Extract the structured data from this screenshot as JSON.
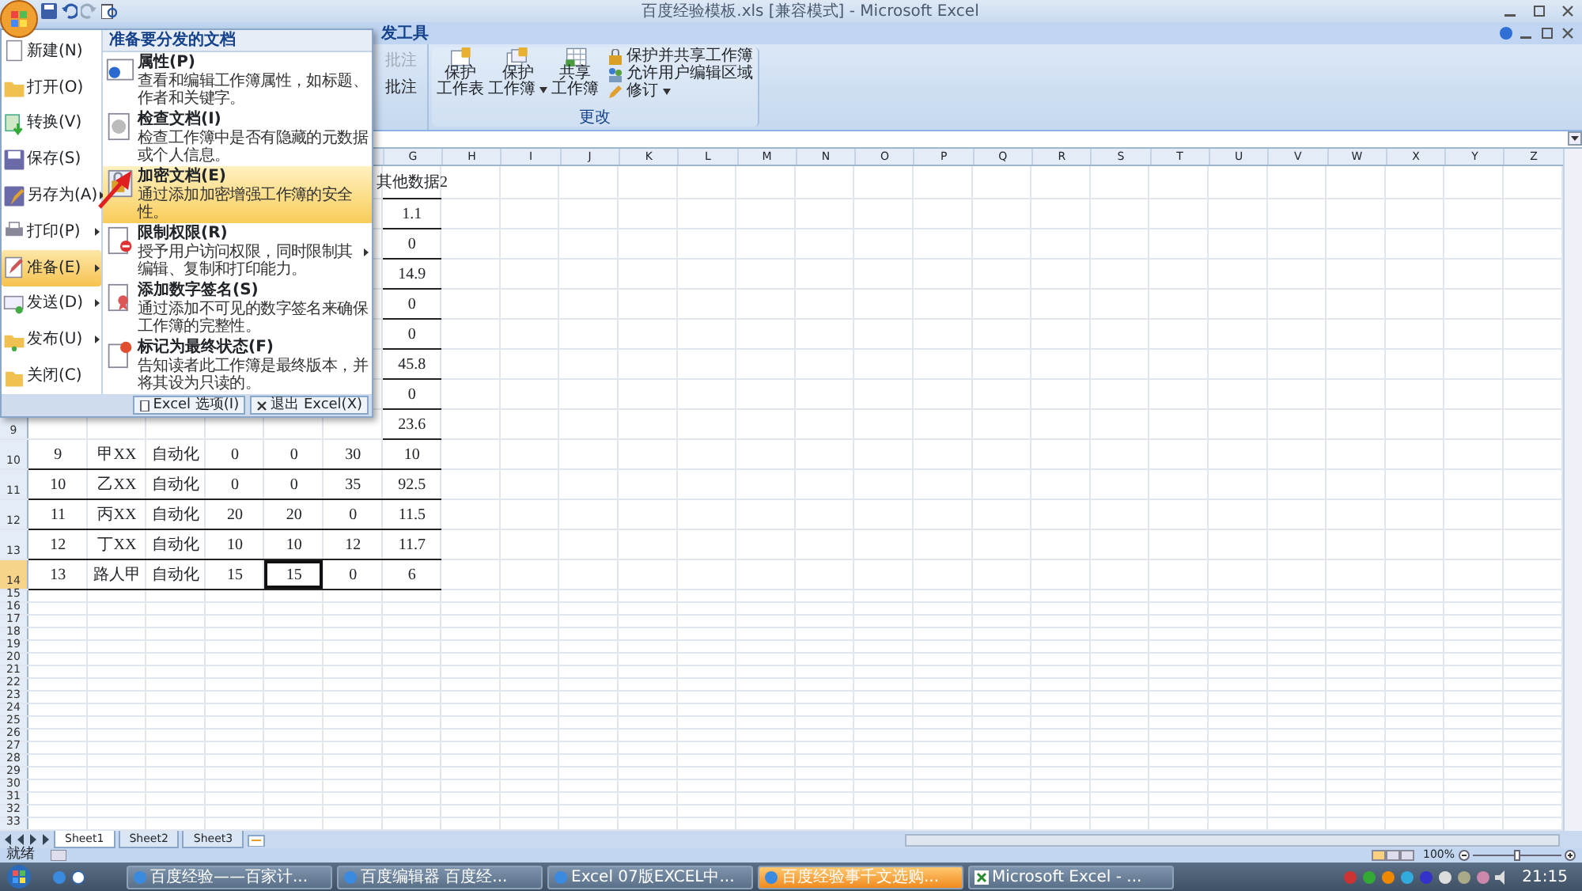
{
  "window": {
    "title": "百度经验模板.xls [兼容模式] - Microsoft Excel"
  },
  "ribbon": {
    "tab_partial": "发工具",
    "commands": [
      {
        "label": "批注",
        "disabled": true
      },
      {
        "label": "批注",
        "disabled": false
      }
    ],
    "group": {
      "title": "更改",
      "large_buttons": [
        {
          "lines": [
            "保护",
            "工作表"
          ],
          "has_menu": false
        },
        {
          "lines": [
            "保护",
            "工作簿"
          ],
          "has_menu": true
        },
        {
          "lines": [
            "共享",
            "工作簿"
          ],
          "has_menu": false
        }
      ],
      "small_buttons": [
        {
          "label": "保护并共享工作簿",
          "has_menu": false
        },
        {
          "label": "允许用户编辑区域",
          "has_menu": false
        },
        {
          "label": "修订",
          "has_menu": true
        }
      ]
    }
  },
  "office_menu": {
    "left_items": [
      {
        "label": "新建(N)",
        "submenu": false,
        "selected": false
      },
      {
        "label": "打开(O)",
        "submenu": false,
        "selected": false
      },
      {
        "label": "转换(V)",
        "submenu": false,
        "selected": false
      },
      {
        "label": "保存(S)",
        "submenu": false,
        "selected": false
      },
      {
        "label": "另存为(A)",
        "submenu": true,
        "selected": false
      },
      {
        "label": "打印(P)",
        "submenu": true,
        "selected": false
      },
      {
        "label": "准备(E)",
        "submenu": true,
        "selected": true
      },
      {
        "label": "发送(D)",
        "submenu": true,
        "selected": false
      },
      {
        "label": "发布(U)",
        "submenu": true,
        "selected": false
      },
      {
        "label": "关闭(C)",
        "submenu": false,
        "selected": false
      }
    ],
    "panel": {
      "title": "准备要分发的文档",
      "items": [
        {
          "title": "属性(P)",
          "description": "查看和编辑工作簿属性，如标题、作者和关键字。",
          "submenu": false,
          "selected": false
        },
        {
          "title": "检查文档(I)",
          "description": "检查工作簿中是否有隐藏的元数据或个人信息。",
          "submenu": false,
          "selected": false
        },
        {
          "title": "加密文档(E)",
          "description": "通过添加加密增强工作簿的安全性。",
          "submenu": false,
          "selected": true
        },
        {
          "title": "限制权限(R)",
          "description": "授予用户访问权限，同时限制其编辑、复制和打印能力。",
          "submenu": true,
          "selected": false
        },
        {
          "title": "添加数字签名(S)",
          "description": "通过添加不可见的数字签名来确保工作簿的完整性。",
          "submenu": false,
          "selected": false
        },
        {
          "title": "标记为最终状态(F)",
          "description": "告知读者此工作簿是最终版本，并将其设为只读的。",
          "submenu": false,
          "selected": false
        }
      ]
    },
    "buttons": [
      "Excel 选项(I)",
      "退出 Excel(X)"
    ]
  },
  "sheet": {
    "columns": [
      "G",
      "H",
      "I",
      "J",
      "K",
      "L",
      "M",
      "N",
      "O",
      "P",
      "Q",
      "R",
      "S",
      "T",
      "U",
      "V",
      "W",
      "X",
      "Y",
      "Z"
    ],
    "rows": [
      {
        "cells": {
          "G": {
            "text": "其他数据2",
            "selected": false
          }
        }
      },
      {
        "cells": {
          "G": {
            "text": "1.1",
            "selected": false
          }
        }
      },
      {
        "cells": {
          "G": {
            "text": "0",
            "selected": false
          }
        }
      },
      {
        "cells": {
          "G": {
            "text": "14.9",
            "selected": false
          }
        }
      },
      {
        "cells": {
          "G": {
            "text": "0",
            "selected": false
          }
        }
      },
      {
        "cells": {
          "G": {
            "text": "0",
            "selected": false
          }
        }
      },
      {
        "cells": {
          "G": {
            "text": "45.8",
            "selected": false
          }
        }
      },
      {
        "cells": {
          "G": {
            "text": "0",
            "selected": false
          }
        }
      },
      {
        "number": "9",
        "selected": false,
        "cells": {
          "G": {
            "text": "23.6",
            "selected": false
          }
        }
      },
      {
        "number": "10",
        "selected": false,
        "cells": {
          "A": {
            "text": "9",
            "selected": false
          },
          "B": {
            "text": "甲XX",
            "selected": false
          },
          "C": {
            "text": "自动化",
            "selected": false
          },
          "D": {
            "text": "0",
            "selected": false
          },
          "E": {
            "text": "0",
            "selected": false
          },
          "F": {
            "text": "30",
            "selected": false
          },
          "G": {
            "text": "10",
            "selected": false
          }
        }
      },
      {
        "number": "11",
        "selected": false,
        "cells": {
          "A": {
            "text": "10",
            "selected": false
          },
          "B": {
            "text": "乙XX",
            "selected": false
          },
          "C": {
            "text": "自动化",
            "selected": false
          },
          "D": {
            "text": "0",
            "selected": false
          },
          "E": {
            "text": "0",
            "selected": false
          },
          "F": {
            "text": "35",
            "selected": false
          },
          "G": {
            "text": "92.5",
            "selected": false
          }
        }
      },
      {
        "number": "12",
        "selected": false,
        "cells": {
          "A": {
            "text": "11",
            "selected": false
          },
          "B": {
            "text": "丙XX",
            "selected": false
          },
          "C": {
            "text": "自动化",
            "selected": false
          },
          "D": {
            "text": "20",
            "selected": false
          },
          "E": {
            "text": "20",
            "selected": false
          },
          "F": {
            "text": "0",
            "selected": false
          },
          "G": {
            "text": "11.5",
            "selected": false
          }
        }
      },
      {
        "number": "13",
        "selected": false,
        "cells": {
          "A": {
            "text": "12",
            "selected": false
          },
          "B": {
            "text": "丁XX",
            "selected": false
          },
          "C": {
            "text": "自动化",
            "selected": false
          },
          "D": {
            "text": "10",
            "selected": false
          },
          "E": {
            "text": "10",
            "selected": false
          },
          "F": {
            "text": "12",
            "selected": false
          },
          "G": {
            "text": "11.7",
            "selected": false
          }
        }
      },
      {
        "number": "14",
        "selected": true,
        "cells": {
          "A": {
            "text": "13",
            "selected": false
          },
          "B": {
            "text": "路人甲",
            "selected": false
          },
          "C": {
            "text": "自动化",
            "selected": false
          },
          "D": {
            "text": "15",
            "selected": false
          },
          "E": {
            "text": "15",
            "selected": true
          },
          "F": {
            "text": "0",
            "selected": false
          },
          "G": {
            "text": "6",
            "selected": false
          }
        }
      },
      {
        "number": "15",
        "selected": false
      },
      {
        "number": "16",
        "selected": false
      },
      {
        "number": "17",
        "selected": false
      },
      {
        "number": "18",
        "selected": false
      },
      {
        "number": "19",
        "selected": false
      },
      {
        "number": "20",
        "selected": false
      },
      {
        "number": "21",
        "selected": false
      },
      {
        "number": "22",
        "selected": false
      },
      {
        "number": "23",
        "selected": false
      },
      {
        "number": "24",
        "selected": false
      },
      {
        "number": "25",
        "selected": false
      },
      {
        "number": "26",
        "selected": false
      },
      {
        "number": "27",
        "selected": false
      },
      {
        "number": "28",
        "selected": false
      },
      {
        "number": "29",
        "selected": false
      },
      {
        "number": "30",
        "selected": false
      },
      {
        "number": "31",
        "selected": false
      },
      {
        "number": "32",
        "selected": false
      },
      {
        "number": "33",
        "selected": false
      }
    ]
  },
  "sheet_tabs": [
    {
      "label": "Sheet1",
      "selected": true
    },
    {
      "label": "Sheet2",
      "selected": false
    },
    {
      "label": "Sheet3",
      "selected": false
    }
  ],
  "status_bar": {
    "text": "就绪",
    "zoom": "100%",
    "zoom_slider": {
      "level": 0.5
    }
  },
  "taskbar": {
    "tasks": [
      {
        "label": "百度经验——百家计...",
        "highlighted": false
      },
      {
        "label": "百度编辑器 百度经...",
        "highlighted": false
      },
      {
        "label": "Excel 07版EXCEL中...",
        "highlighted": false
      },
      {
        "label": "百度经验事千文选购...",
        "highlighted": true
      },
      {
        "label": "Microsoft Excel - ...",
        "highlighted": false
      }
    ],
    "clock": "21:15"
  }
}
